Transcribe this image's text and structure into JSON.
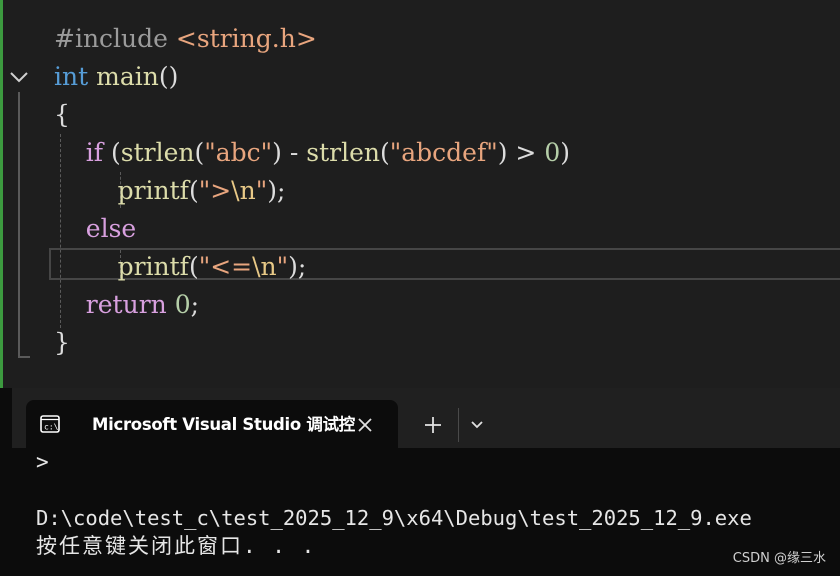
{
  "editor": {
    "lines": [
      [
        {
          "t": "#include ",
          "c": "#9b9b9b"
        },
        {
          "t": "<string.h>",
          "c": "#e8a57e"
        }
      ],
      [
        {
          "t": "int",
          "c": "#569cd6"
        },
        {
          "t": " ",
          "c": "#dcdcdc"
        },
        {
          "t": "main",
          "c": "#dcdcaa"
        },
        {
          "t": "()",
          "c": "#dcdcdc"
        }
      ],
      [
        {
          "t": "{",
          "c": "#dcdcdc"
        }
      ],
      [
        {
          "t": "    ",
          "c": "#dcdcdc"
        },
        {
          "t": "if",
          "c": "#d8a0df"
        },
        {
          "t": " (",
          "c": "#dcdcdc"
        },
        {
          "t": "strlen",
          "c": "#dcdcaa"
        },
        {
          "t": "(",
          "c": "#dcdcdc"
        },
        {
          "t": "\"abc\"",
          "c": "#e8a57e"
        },
        {
          "t": ") - ",
          "c": "#dcdcdc"
        },
        {
          "t": "strlen",
          "c": "#dcdcaa"
        },
        {
          "t": "(",
          "c": "#dcdcdc"
        },
        {
          "t": "\"abcdef\"",
          "c": "#e8a57e"
        },
        {
          "t": ") > ",
          "c": "#dcdcdc"
        },
        {
          "t": "0",
          "c": "#b5cea8"
        },
        {
          "t": ")",
          "c": "#dcdcdc"
        }
      ],
      [
        {
          "t": "        ",
          "c": "#dcdcdc"
        },
        {
          "t": "printf",
          "c": "#dcdcaa"
        },
        {
          "t": "(",
          "c": "#dcdcdc"
        },
        {
          "t": "\">",
          "c": "#e8a57e"
        },
        {
          "t": "\\n",
          "c": "#e8c987"
        },
        {
          "t": "\"",
          "c": "#e8a57e"
        },
        {
          "t": ");",
          "c": "#dcdcdc"
        }
      ],
      [
        {
          "t": "    ",
          "c": "#dcdcdc"
        },
        {
          "t": "else",
          "c": "#d8a0df"
        }
      ],
      [
        {
          "t": "        ",
          "c": "#dcdcdc"
        },
        {
          "t": "printf",
          "c": "#dcdcaa"
        },
        {
          "t": "(",
          "c": "#dcdcdc"
        },
        {
          "t": "\"<=",
          "c": "#e8a57e"
        },
        {
          "t": "\\n",
          "c": "#e8c987"
        },
        {
          "t": "\"",
          "c": "#e8a57e"
        },
        {
          "t": ");",
          "c": "#dcdcdc"
        }
      ],
      [
        {
          "t": "    ",
          "c": "#dcdcdc"
        },
        {
          "t": "return",
          "c": "#d8a0df"
        },
        {
          "t": " ",
          "c": "#dcdcdc"
        },
        {
          "t": "0",
          "c": "#b5cea8"
        },
        {
          "t": ";",
          "c": "#dcdcdc"
        }
      ],
      [
        {
          "t": "}",
          "c": "#dcdcdc"
        }
      ]
    ]
  },
  "terminal": {
    "tab_title": "Microsoft Visual Studio 调试控",
    "tab_icon": "console-icon",
    "close_icon": "close-icon",
    "new_tab_icon": "plus-icon",
    "dropdown_icon": "chevron-down-icon",
    "lines": [
      ">",
      "",
      "D:\\code\\test_c\\test_2025_12_9\\x64\\Debug\\test_2025_12_9.exe",
      "按任意键关闭此窗口. . ."
    ]
  },
  "watermark": "CSDN @缘三水",
  "colors": {
    "editor_bg": "#1e1e1e",
    "terminal_bg": "#0c0c0c",
    "tabbar_bg": "#202020",
    "keyword_blue": "#569cd6",
    "keyword_purple": "#d8a0df",
    "function_yellow": "#dcdcaa",
    "string_orange": "#e8a57e",
    "number_green": "#b5cea8"
  }
}
